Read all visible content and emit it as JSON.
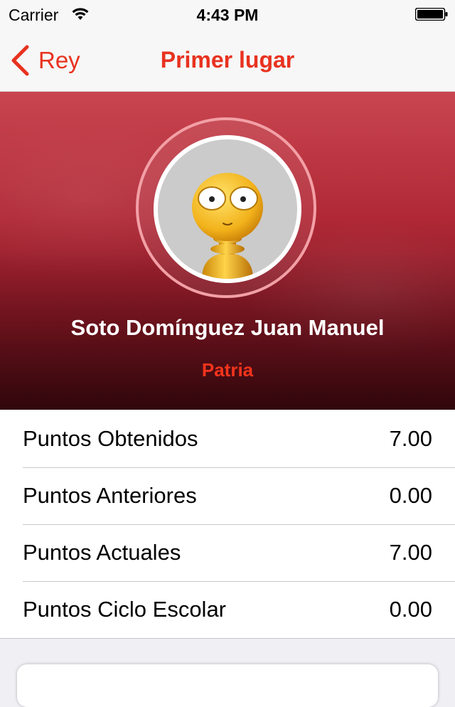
{
  "status_bar": {
    "carrier": "Carrier",
    "time": "4:43 PM"
  },
  "nav": {
    "back_label": "Rey",
    "title": "Primer lugar",
    "accent_color": "#e8321f"
  },
  "profile": {
    "name": "Soto Domínguez Juan Manuel",
    "team": "Patria",
    "avatar_icon": "chess-pawn-character-icon"
  },
  "stats": [
    {
      "label": "Puntos Obtenidos",
      "value": "7.00"
    },
    {
      "label": "Puntos Anteriores",
      "value": "0.00"
    },
    {
      "label": "Puntos Actuales",
      "value": "7.00"
    },
    {
      "label": "Puntos Ciclo Escolar",
      "value": "0.00"
    }
  ]
}
